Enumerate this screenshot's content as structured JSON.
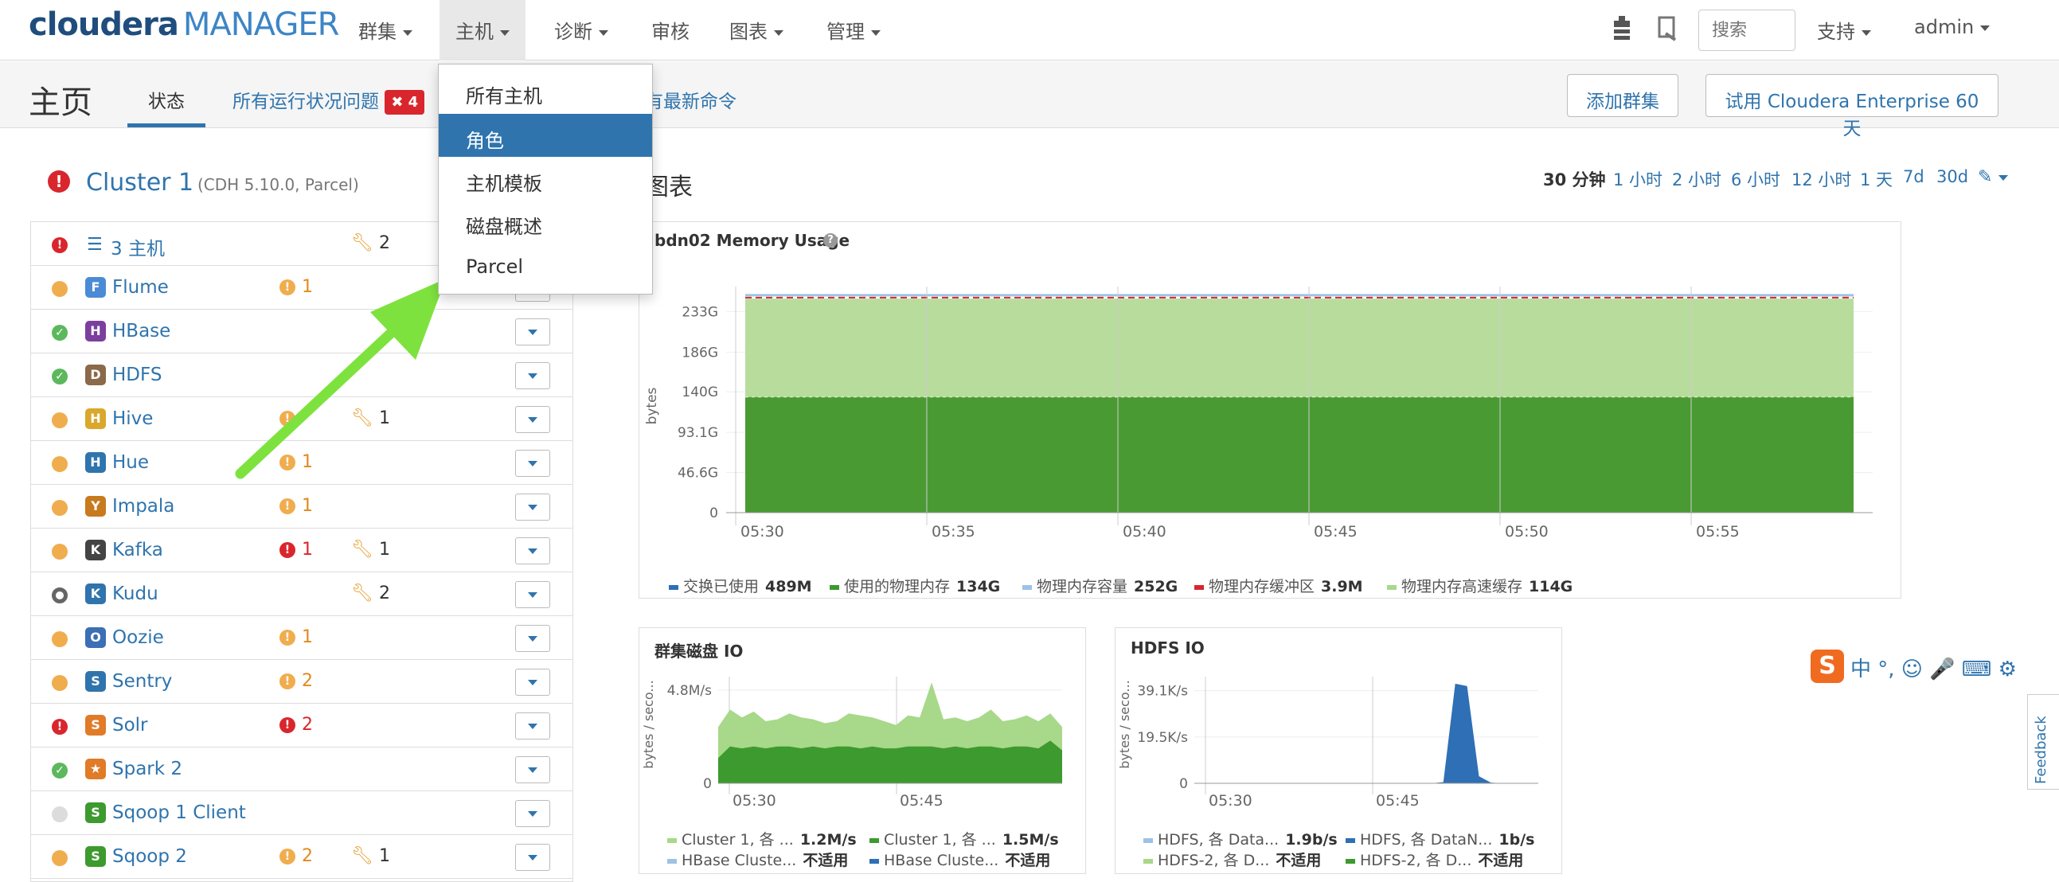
{
  "navbar": {
    "logo_main": "cloudera",
    "logo_sub": "MANAGER",
    "items": [
      "群集",
      "主机",
      "诊断",
      "审核",
      "图表",
      "管理"
    ],
    "search_placeholder": "搜索",
    "support": "支持",
    "user": "admin"
  },
  "subheader": {
    "title": "主页",
    "tab_status": "状态",
    "tab_issues": "所有运行状况问题",
    "issues_badge": "4",
    "tab_commands": "有最新命令",
    "add_cluster": "添加群集",
    "trial": "试用 Cloudera Enterprise 60 天"
  },
  "hosts_menu": {
    "items": [
      "所有主机",
      "角色",
      "主机模板",
      "磁盘概述",
      "Parcel"
    ],
    "highlighted": 1
  },
  "cluster": {
    "name": "Cluster 1",
    "meta": "(CDH 5.10.0, Parcel)",
    "hosts_label": "3 主机",
    "hosts_config": "2",
    "services": [
      {
        "name": "Flume",
        "status": "warn",
        "alerts": "1",
        "alert_type": "warn",
        "config": ""
      },
      {
        "name": "HBase",
        "status": "ok",
        "alerts": "",
        "alert_type": "",
        "config": ""
      },
      {
        "name": "HDFS",
        "status": "ok",
        "alerts": "",
        "alert_type": "",
        "config": ""
      },
      {
        "name": "Hive",
        "status": "warn",
        "alerts": "",
        "alert_type": "warn",
        "config": "1"
      },
      {
        "name": "Hue",
        "status": "warn",
        "alerts": "1",
        "alert_type": "warn",
        "config": ""
      },
      {
        "name": "Impala",
        "status": "warn",
        "alerts": "1",
        "alert_type": "warn",
        "config": ""
      },
      {
        "name": "Kafka",
        "status": "warn",
        "alerts": "1",
        "alert_type": "err",
        "config": "1"
      },
      {
        "name": "Kudu",
        "status": "dark",
        "alerts": "",
        "alert_type": "",
        "config": "2"
      },
      {
        "name": "Oozie",
        "status": "warn",
        "alerts": "1",
        "alert_type": "warn",
        "config": ""
      },
      {
        "name": "Sentry",
        "status": "warn",
        "alerts": "2",
        "alert_type": "warn",
        "config": ""
      },
      {
        "name": "Solr",
        "status": "err",
        "alerts": "2",
        "alert_type": "err",
        "config": ""
      },
      {
        "name": "Spark 2",
        "status": "ok",
        "alerts": "",
        "alert_type": "",
        "config": ""
      },
      {
        "name": "Sqoop 1 Client",
        "status": "grey",
        "alerts": "",
        "alert_type": "",
        "config": ""
      },
      {
        "name": "Sqoop 2",
        "status": "warn",
        "alerts": "2",
        "alert_type": "warn",
        "config": "1"
      }
    ]
  },
  "charts": {
    "title": "图表",
    "time_ranges": [
      "30 分钟",
      "1 小时",
      "2 小时",
      "6 小时",
      "12 小时",
      "1 天",
      "7d",
      "30d"
    ],
    "memory": {
      "title": "bdn02 Memory Usage",
      "ylabel": "bytes",
      "legend": [
        {
          "label": "交换已使用",
          "value": "489M",
          "color": "#2f6fb5"
        },
        {
          "label": "使用的物理内存",
          "value": "134G",
          "color": "#3d9a2e"
        },
        {
          "label": "物理内存容量",
          "value": "252G",
          "color": "#9cc3e6"
        },
        {
          "label": "物理内存缓冲区",
          "value": "3.9M",
          "color": "#d9262d"
        },
        {
          "label": "物理内存高速缓存",
          "value": "114G",
          "color": "#a8d889"
        }
      ]
    },
    "disk_io": {
      "title": "群集磁盘 IO",
      "ylabel": "bytes / seco...",
      "legend": [
        {
          "label": "Cluster 1, 各 ...",
          "value": "1.2M/s",
          "color": "#a8d889"
        },
        {
          "label": "Cluster 1, 各 ...",
          "value": "1.5M/s",
          "color": "#3d9a2e"
        },
        {
          "label": "HBase Cluste...",
          "value": "不适用",
          "color": "#9cc3e6"
        },
        {
          "label": "HBase Cluste...",
          "value": "不适用",
          "color": "#2f6fb5"
        }
      ]
    },
    "hdfs_io": {
      "title": "HDFS IO",
      "ylabel": "bytes / seco...",
      "legend": [
        {
          "label": "HDFS, 各 Data...",
          "value": "1.9b/s",
          "color": "#9cc3e6"
        },
        {
          "label": "HDFS, 各 DataN...",
          "value": "1b/s",
          "color": "#2f6fb5"
        },
        {
          "label": "HDFS-2, 各 D...",
          "value": "不适用",
          "color": "#a8d889"
        },
        {
          "label": "HDFS-2, 各 D...",
          "value": "不适用",
          "color": "#3d9a2e"
        }
      ]
    }
  },
  "chart_data": [
    {
      "type": "area",
      "title": "bdn02 Memory Usage",
      "ylabel": "bytes",
      "x": [
        "05:30",
        "05:35",
        "05:40",
        "05:45",
        "05:50",
        "05:55"
      ],
      "yticks": [
        "0",
        "46.6G",
        "93.1G",
        "140G",
        "186G",
        "233G"
      ],
      "ylim": [
        0,
        262
      ],
      "series": [
        {
          "name": "交换已使用",
          "values": [
            0.489,
            0.489,
            0.489,
            0.489,
            0.489,
            0.489
          ]
        },
        {
          "name": "使用的物理内存",
          "values": [
            134,
            134,
            134,
            134,
            134,
            134
          ]
        },
        {
          "name": "物理内存容量",
          "values": [
            252,
            252,
            252,
            252,
            252,
            252
          ]
        },
        {
          "name": "物理内存缓冲区",
          "values": [
            0.0039,
            0.0039,
            0.0039,
            0.0039,
            0.0039,
            0.0039
          ]
        },
        {
          "name": "物理内存高速缓存",
          "values": [
            114,
            114,
            114,
            114,
            114,
            114
          ]
        }
      ]
    },
    {
      "type": "area",
      "title": "群集磁盘 IO",
      "ylabel": "bytes / seco...",
      "x": [
        "05:30",
        "05:45"
      ],
      "yticks": [
        "0",
        "4.8M/s"
      ],
      "ylim": [
        0,
        5.5
      ],
      "series": [
        {
          "name": "Cluster 1, 各 ...",
          "values": [
            2.9,
            3.8,
            3.4,
            3.7,
            3.2,
            3.3,
            3.6,
            3.4,
            3.3,
            3.1,
            3.2,
            3.6,
            3.5,
            3.4,
            3.2,
            3.0,
            3.5,
            3.4,
            5.2,
            3.3,
            3.4,
            3.2,
            3.4,
            3.8,
            3.2,
            3.3,
            3.5,
            3.2,
            3.6,
            2.9
          ]
        },
        {
          "name": "Cluster 1, 各 ...",
          "values": [
            1.3,
            1.9,
            1.8,
            1.9,
            1.8,
            1.9,
            1.9,
            1.8,
            1.9,
            1.8,
            1.9,
            1.9,
            1.8,
            1.9,
            1.8,
            1.8,
            1.9,
            1.9,
            1.9,
            1.8,
            1.9,
            1.8,
            1.9,
            1.9,
            1.8,
            1.9,
            1.9,
            1.8,
            2.2,
            1.7
          ]
        }
      ]
    },
    {
      "type": "area",
      "title": "HDFS IO",
      "ylabel": "bytes / seco...",
      "x": [
        "05:30",
        "05:45"
      ],
      "yticks": [
        "0",
        "19.5K/s",
        "39.1K/s"
      ],
      "ylim": [
        0,
        45
      ],
      "series": [
        {
          "name": "HDFS, 各 DataN...",
          "values": [
            0,
            0,
            0,
            0,
            0,
            0,
            0,
            0,
            0,
            0,
            0,
            0,
            0,
            0,
            0,
            0,
            0,
            0,
            0,
            0,
            0,
            0.5,
            42,
            41,
            3,
            0.3,
            0,
            0,
            0,
            0
          ]
        }
      ]
    }
  ]
}
